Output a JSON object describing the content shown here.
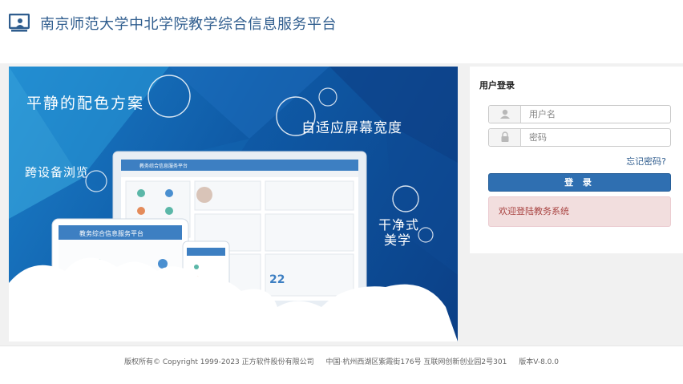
{
  "header": {
    "title": "南京师范大学中北学院教学综合信息服务平台"
  },
  "banner": {
    "tagline_1": "平静的配色方案",
    "tagline_2": "自适应屏幕宽度",
    "tagline_3": "跨设备浏览",
    "tagline_4a": "干净式",
    "tagline_4b": "美学",
    "screen_title": "教务综合信息服务平台",
    "tablet_title": "教务综合信息服务平台",
    "calendar_day": "22"
  },
  "login": {
    "title": "用户登录",
    "username_placeholder": "用户名",
    "password_placeholder": "密码",
    "forgot_label": "忘记密码?",
    "submit_label": "登 录",
    "message": "欢迎登陆教务系统"
  },
  "footer": {
    "copyright": "版权所有© Copyright 1999-2023 正方软件股份有限公司",
    "address": "中国·杭州西湖区紫霞街176号 互联网创新创业园2号301",
    "version": "版本V-8.0.0"
  },
  "colors": {
    "brand": "#2f5d8e",
    "button": "#2f6fb1",
    "alert_bg": "#f2dede",
    "alert_text": "#a94442"
  }
}
